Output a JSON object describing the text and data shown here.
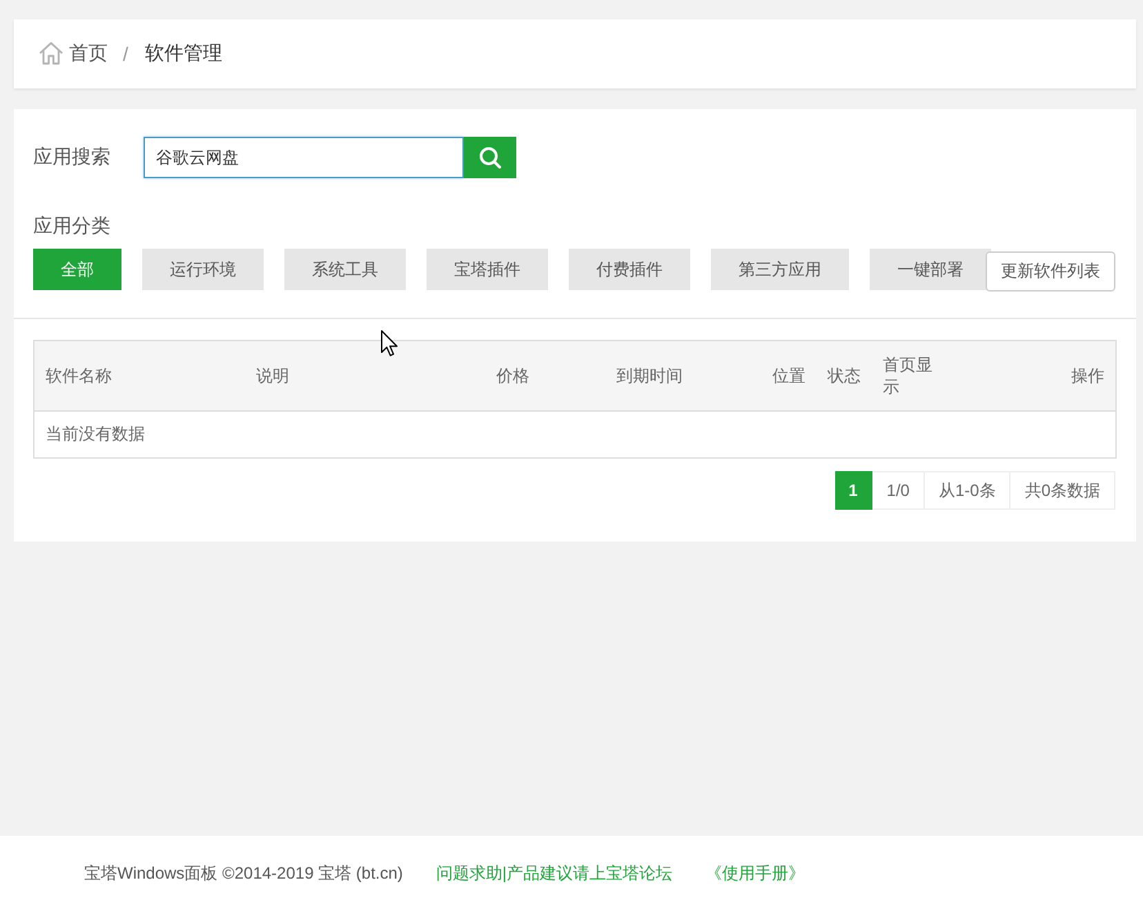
{
  "breadcrumb": {
    "items": [
      {
        "kind": "home",
        "label": "首页"
      },
      {
        "kind": "separator",
        "label": "/"
      },
      {
        "kind": "current",
        "label": "软件管理"
      }
    ]
  },
  "search": {
    "label": "应用搜索",
    "value": "谷歌云网盘"
  },
  "categories": {
    "label": "应用分类",
    "items": [
      {
        "label": "全部",
        "selected": true
      },
      {
        "label": "运行环境",
        "selected": false
      },
      {
        "label": "系统工具",
        "selected": false
      },
      {
        "label": "宝塔插件",
        "selected": false
      },
      {
        "label": "付费插件",
        "selected": false
      },
      {
        "label": "第三方应用",
        "selected": false
      },
      {
        "label": "一键部署",
        "selected": false
      }
    ],
    "refresh_button": "更新软件列表"
  },
  "table": {
    "columns": [
      "软件名称",
      "说明",
      "价格",
      "到期时间",
      "位置",
      "状态",
      "首页显示",
      "操作"
    ],
    "empty_message": "当前没有数据"
  },
  "pagination": {
    "current_page": "1",
    "page_count": "1/0",
    "range": "从1-0条",
    "total": "共0条数据"
  },
  "footer": {
    "copyright": "宝塔Windows面板 ©2014-2019 宝塔 (bt.cn)",
    "links": [
      "问题求助|产品建议请上宝塔论坛",
      "《使用手册》"
    ]
  }
}
